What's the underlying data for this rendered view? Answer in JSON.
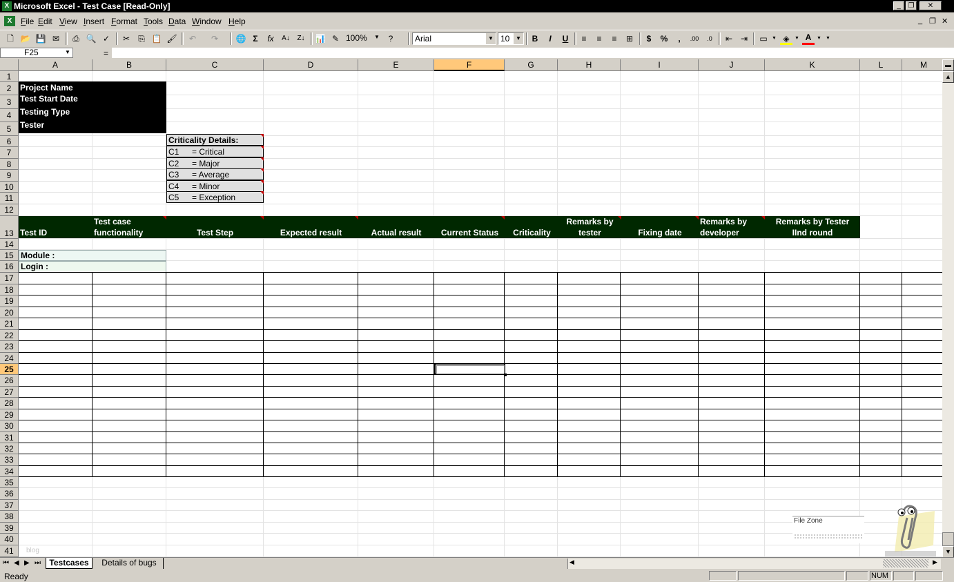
{
  "window": {
    "title": "Microsoft Excel - Test Case  [Read-Only]",
    "app_icon": "X"
  },
  "menu": [
    "File",
    "Edit",
    "View",
    "Insert",
    "Format",
    "Tools",
    "Data",
    "Window",
    "Help"
  ],
  "toolbar": {
    "zoom": "100%",
    "font": "Arial",
    "font_size": "10",
    "bold": "B",
    "italic": "I",
    "underline": "U",
    "currency": "$",
    "percent": "%",
    "comma": ",",
    "sum": "Σ",
    "fx": "fx"
  },
  "formula": {
    "namebox": "F25",
    "eq": "="
  },
  "columns": [
    "A",
    "B",
    "C",
    "D",
    "E",
    "F",
    "G",
    "H",
    "I",
    "J",
    "K",
    "L",
    "M"
  ],
  "rows": [
    "1",
    "2",
    "3",
    "4",
    "5",
    "6",
    "7",
    "8",
    "9",
    "10",
    "11",
    "12",
    "13",
    "14",
    "15",
    "16",
    "17",
    "18",
    "19",
    "20",
    "21",
    "22",
    "23",
    "24",
    "25",
    "26",
    "27",
    "28",
    "29",
    "30",
    "31",
    "32",
    "33",
    "34",
    "35",
    "36",
    "37",
    "38",
    "39",
    "40",
    "41"
  ],
  "project_info": [
    "Project Name",
    "Test Start Date",
    "Testing Type",
    "Tester"
  ],
  "criticality": {
    "title": "Criticality Details:",
    "items": [
      {
        "code": "C1",
        "label": "= Critical"
      },
      {
        "code": "C2",
        "label": "= Major"
      },
      {
        "code": "C3",
        "label": "= Average"
      },
      {
        "code": "C4",
        "label": "= Minor"
      },
      {
        "code": "C5",
        "label": "= Exception"
      }
    ]
  },
  "headers": {
    "test_id": "Test ID",
    "functionality_1": "Test case",
    "functionality_2": "functionality",
    "test_step": "Test Step",
    "expected": "Expected result",
    "actual": "Actual result",
    "status": "Current Status",
    "criticality": "Criticality",
    "remarks_tester_1": "Remarks by",
    "remarks_tester_2": "tester",
    "fixing": "Fixing date",
    "remarks_dev_1": "Remarks by",
    "remarks_dev_2": "developer",
    "remarks_round_1": "Remarks by Tester",
    "remarks_round_2": "IInd round"
  },
  "module_label": "Module :",
  "login_label": "Login :",
  "watermark": "blog",
  "file_zone": "File Zone",
  "sheet_tabs": [
    "Testcases",
    "Details of bugs"
  ],
  "status": {
    "ready": "Ready",
    "num": "NUM"
  }
}
